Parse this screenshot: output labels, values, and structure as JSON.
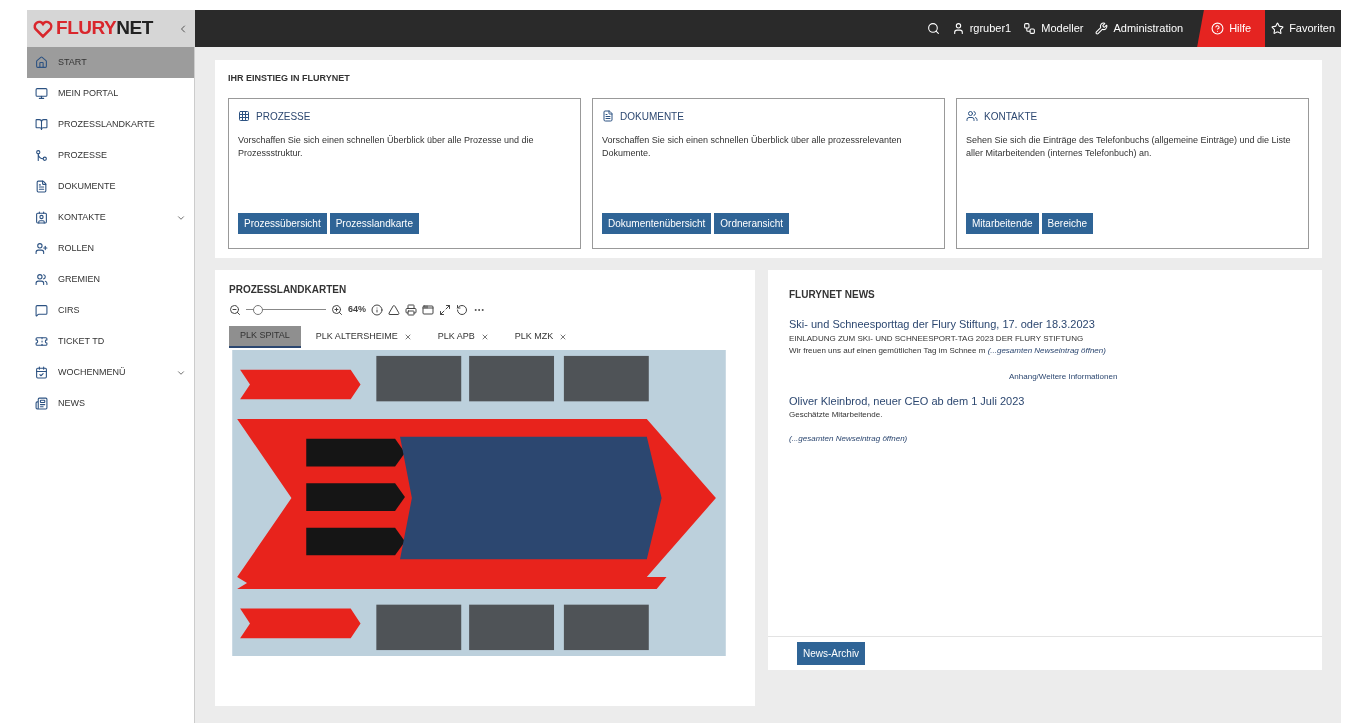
{
  "brand": {
    "logo_parts": [
      "FLURY",
      "NET"
    ]
  },
  "topbar": {
    "items": [
      {
        "kind": "search"
      },
      {
        "kind": "user",
        "label": "rgruber1",
        "highlighted": false
      },
      {
        "kind": "modeller",
        "label": "Modeller",
        "highlighted": false
      },
      {
        "kind": "admin",
        "label": "Administration",
        "highlighted": false
      },
      {
        "kind": "help",
        "label": "Hilfe",
        "highlighted": true
      },
      {
        "kind": "favorites",
        "label": "Favoriten",
        "highlighted": false
      }
    ]
  },
  "sidebar": {
    "items": [
      {
        "kind": "home",
        "label": "START",
        "selected": true,
        "has_submenu": false
      },
      {
        "kind": "portal",
        "label": "MEIN PORTAL",
        "selected": false,
        "has_submenu": false
      },
      {
        "kind": "map",
        "label": "PROZESSLANDKARTE",
        "selected": false,
        "has_submenu": false
      },
      {
        "kind": "process",
        "label": "PROZESSE",
        "selected": false,
        "has_submenu": false
      },
      {
        "kind": "docs",
        "label": "DOKUMENTE",
        "selected": false,
        "has_submenu": false
      },
      {
        "kind": "contacts",
        "label": "KONTAKTE",
        "selected": false,
        "has_submenu": true
      },
      {
        "kind": "roles",
        "label": "ROLLEN",
        "selected": false,
        "has_submenu": false
      },
      {
        "kind": "boards",
        "label": "GREMIEN",
        "selected": false,
        "has_submenu": false
      },
      {
        "kind": "cirs",
        "label": "CIRS",
        "selected": false,
        "has_submenu": false
      },
      {
        "kind": "ticket",
        "label": "TICKET TD",
        "selected": false,
        "has_submenu": false
      },
      {
        "kind": "menu",
        "label": "WOCHENMENÜ",
        "selected": false,
        "has_submenu": true
      },
      {
        "kind": "news",
        "label": "NEWS",
        "selected": false,
        "has_submenu": false
      }
    ]
  },
  "entry": {
    "title": "IHR EINSTIEG IN FLURYNET",
    "cards": [
      {
        "kind": "processes",
        "title": "PROZESSE",
        "text": "Vorschaffen Sie sich einen schnellen Überblick über alle Prozesse und die Prozessstruktur.",
        "buttons": [
          "Prozessübersicht",
          "Prozesslandkarte"
        ]
      },
      {
        "kind": "documents",
        "title": "DOKUMENTE",
        "text": "Vorschaffen Sie sich einen schnellen Überblick über alle prozessrelevanten Dokumente.",
        "buttons": [
          "Dokumentenübersicht",
          "Ordneransicht"
        ]
      },
      {
        "kind": "contacts",
        "title": "KONTAKTE",
        "text": "Sehen Sie sich die Einträge des Telefonbuchs (allgemeine Einträge) und die Liste aller Mitarbeitenden (internes Telefonbuch) an.",
        "buttons": [
          "Mitarbeitende",
          "Bereiche"
        ]
      }
    ]
  },
  "maps": {
    "title": "PROZESSLANDKARTEN",
    "zoom": {
      "level": 0.15,
      "reading": "64%"
    },
    "tabs": [
      {
        "label": "PLK SPITAL",
        "selected": true,
        "closable": false
      },
      {
        "label": "PLK ALTERSHEIME",
        "selected": false,
        "closable": true
      },
      {
        "label": "PLK APB",
        "selected": false,
        "closable": true
      },
      {
        "label": "PLK MZK",
        "selected": false,
        "closable": true
      }
    ]
  },
  "news": {
    "title": "FLURYNET NEWS",
    "items": [
      {
        "kind": "inline",
        "title": "Ski- und Schneesporttag der Flury Stiftung, 17. oder 18.3.2023",
        "headline": "EINLADUNG ZUM SKI- UND SCHNEESPORT-TAG 2023 DER FLURY STIFTUNG",
        "text": "Wir freuen uns auf einen gemütlichen Tag im Schnee m",
        "more_link": "(...gesamten Newseintrag öffnen)",
        "attachment": "Anhang/Weitere Informationen"
      },
      {
        "kind": "block",
        "title": "Oliver Kleinbrod, neuer CEO ab dem 1 Juli 2023",
        "text": "Geschätzte Mitarbeitende.",
        "more_link": "(...gesamten Newseintrag öffnen)"
      }
    ],
    "archive_button": "News-Archiv"
  }
}
